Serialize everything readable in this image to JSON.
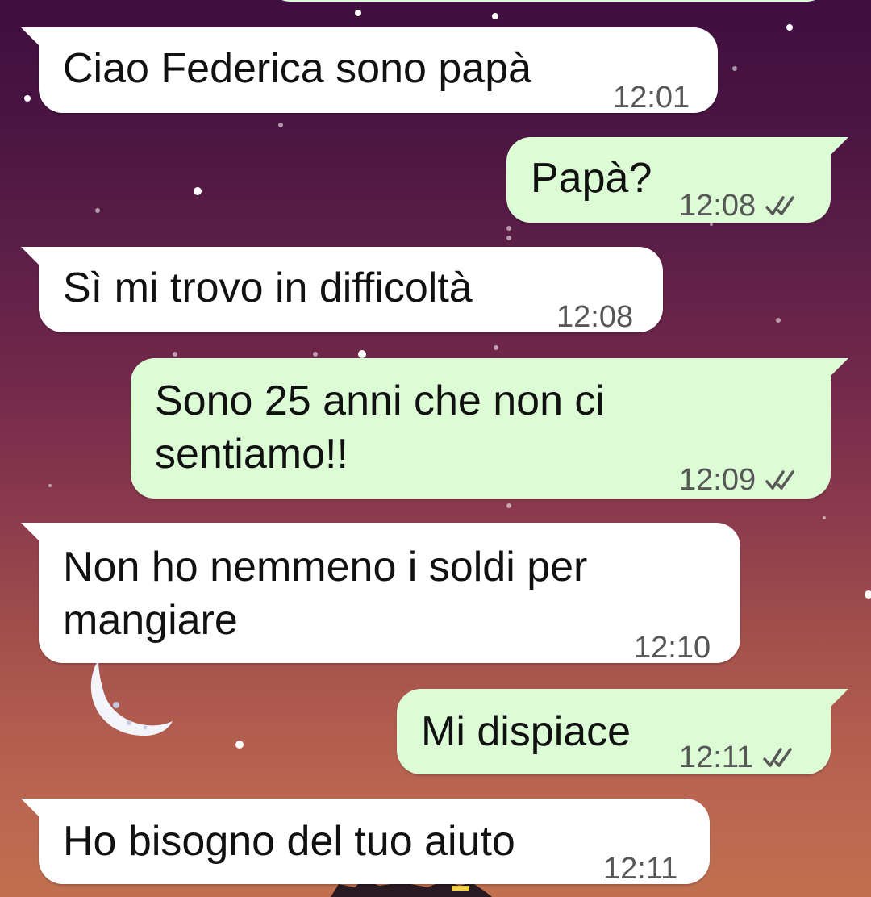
{
  "colors": {
    "incoming_bubble": "#ffffff",
    "outgoing_bubble": "#dcfcd6",
    "tick_color": "#575757"
  },
  "icons": {
    "read_receipt": "double-check-icon",
    "wallpaper_moon": "crescent-moon-icon"
  },
  "messages": [
    {
      "direction": "incoming",
      "text": "Ciao Federica sono papà",
      "time": "12:01"
    },
    {
      "direction": "outgoing",
      "text": "Papà?",
      "time": "12:08",
      "status": "read"
    },
    {
      "direction": "incoming",
      "text": "Sì mi trovo in difficoltà",
      "time": "12:08"
    },
    {
      "direction": "outgoing",
      "text_lines": [
        "Sono 25 anni che non ci",
        "sentiamo!!"
      ],
      "time": "12:09",
      "status": "read"
    },
    {
      "direction": "incoming",
      "text_lines": [
        "Non ho nemmeno i soldi per",
        "mangiare"
      ],
      "time": "12:10"
    },
    {
      "direction": "outgoing",
      "text": "Mi dispiace",
      "time": "12:11",
      "status": "read"
    },
    {
      "direction": "incoming",
      "text": "Ho bisogno del tuo aiuto",
      "time": "12:11"
    }
  ]
}
